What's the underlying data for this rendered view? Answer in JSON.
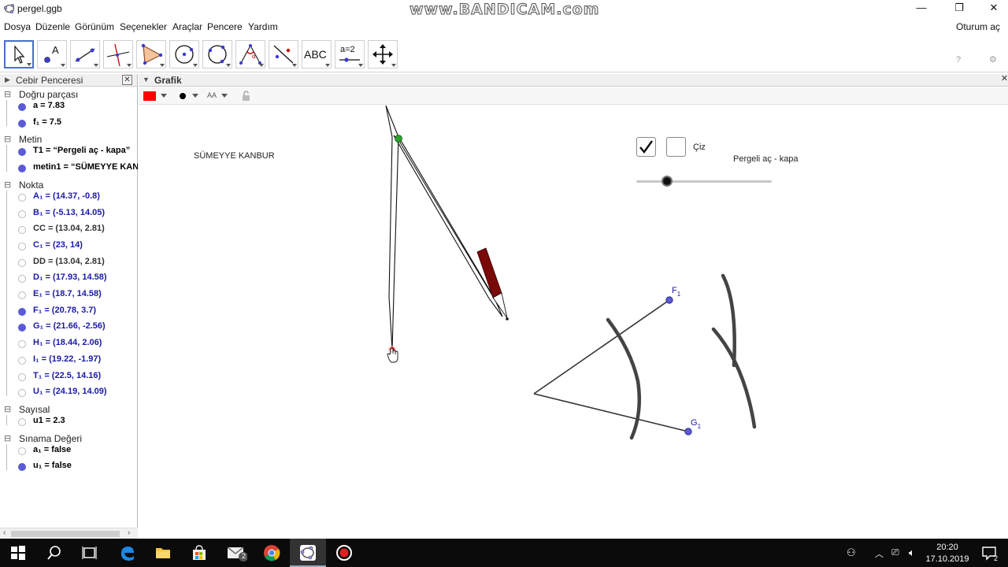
{
  "window": {
    "title": "pergel.ggb",
    "watermark": "www.BANDICAM.com",
    "minimize": "—",
    "maximize": "❐",
    "close": "✕"
  },
  "menu": {
    "items": [
      "Dosya",
      "Düzenle",
      "Görünüm",
      "Seçenekler",
      "Araçlar",
      "Pencere",
      "Yardım"
    ],
    "login": "Oturum aç"
  },
  "toolbar": {
    "text_tool_label": "ABC",
    "slider_tool_label": "a=2"
  },
  "algebra": {
    "title": "Cebir Penceresi",
    "close": "✕",
    "categories": [
      {
        "name": "Doğru parçası",
        "items": [
          {
            "label": "a = 7.83",
            "visible": true,
            "color": "#000000"
          },
          {
            "label": "f₁ = 7.5",
            "visible": true,
            "color": "#000000"
          }
        ]
      },
      {
        "name": "Metin",
        "items": [
          {
            "label": "T1 = “Pergeli aç - kapa”",
            "visible": true,
            "color": "#000000"
          },
          {
            "label": "metin1 = “SÜMEYYE KAN",
            "visible": true,
            "color": "#000000"
          }
        ]
      },
      {
        "name": "Nokta",
        "items": [
          {
            "label": "A₁ = (14.37, -0.8)",
            "visible": false,
            "color": "#1a1aa6"
          },
          {
            "label": "B₁ = (-5.13, 14.05)",
            "visible": false,
            "color": "#1a1aa6"
          },
          {
            "label": "CC = (13.04, 2.81)",
            "visible": false,
            "color": "#333333"
          },
          {
            "label": "C₁ = (23, 14)",
            "visible": false,
            "color": "#1a1aa6"
          },
          {
            "label": "DD = (13.04, 2.81)",
            "visible": false,
            "color": "#333333"
          },
          {
            "label": "D₁ = (17.93, 14.58)",
            "visible": false,
            "color": "#1a1aa6"
          },
          {
            "label": "E₁ = (18.7, 14.58)",
            "visible": false,
            "color": "#1a1aa6"
          },
          {
            "label": "F₁ = (20.78, 3.7)",
            "visible": true,
            "color": "#1a1aa6"
          },
          {
            "label": "G₁ = (21.66, -2.56)",
            "visible": true,
            "color": "#1a1aa6"
          },
          {
            "label": "H₁ = (18.44, 2.06)",
            "visible": false,
            "color": "#1a1aa6"
          },
          {
            "label": "I₁ = (19.22, -1.97)",
            "visible": false,
            "color": "#1a1aa6"
          },
          {
            "label": "T₁ = (22.5, 14.16)",
            "visible": false,
            "color": "#1a1aa6"
          },
          {
            "label": "U₁ = (24.19, 14.09)",
            "visible": false,
            "color": "#1a1aa6"
          }
        ]
      },
      {
        "name": "Sayısal",
        "items": [
          {
            "label": "u1 = 2.3",
            "visible": false,
            "color": "#000000"
          }
        ]
      },
      {
        "name": "Sınama Değeri",
        "items": [
          {
            "label": "a₁ = false",
            "visible": false,
            "color": "#000000"
          },
          {
            "label": "u₁ = false",
            "visible": true,
            "color": "#000000"
          }
        ]
      }
    ]
  },
  "graphics": {
    "title": "Grafik",
    "close": "✕",
    "style_color": "#ff0000",
    "font_size_label": "AA",
    "author_text": "SÜMEYYE KANBUR",
    "checkbox_label": "Çiz",
    "slider_caption": "Pergeli aç - kapa",
    "slider_value": 0.2,
    "point_labels": {
      "f": "F",
      "g": "G",
      "sub": "1"
    }
  },
  "taskbar": {
    "time": "20:20",
    "date": "17.10.2019",
    "mail_badge": "2",
    "notif_badge": "2"
  },
  "colors": {
    "accent": "#4a6fc7",
    "point_blue": "#5b5bd6",
    "pencil": "#7a0a0a",
    "pivot_green": "#2e9e2e"
  }
}
